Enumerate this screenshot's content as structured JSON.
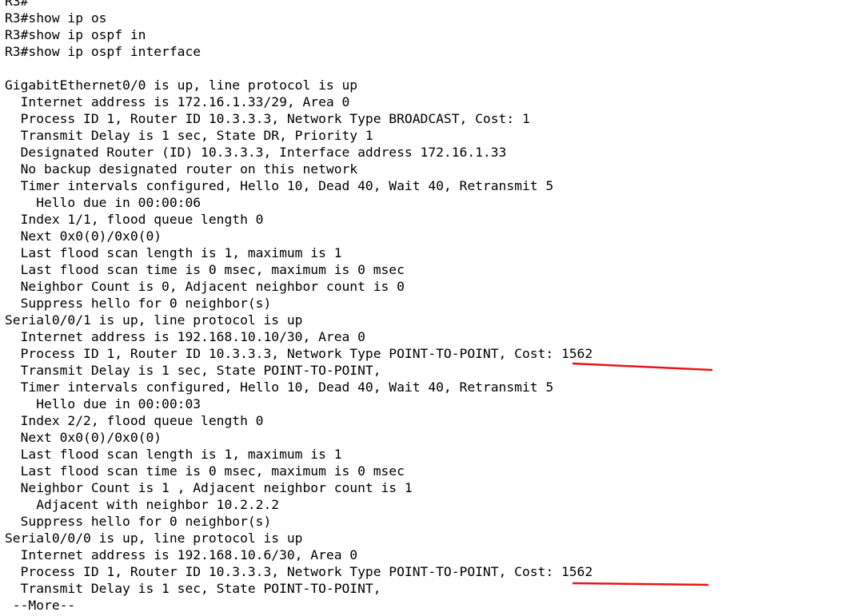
{
  "terminal": {
    "lines": [
      "R3#",
      "R3#show ip os",
      "R3#show ip ospf in",
      "R3#show ip ospf interface",
      "",
      "GigabitEthernet0/0 is up, line protocol is up",
      "  Internet address is 172.16.1.33/29, Area 0",
      "  Process ID 1, Router ID 10.3.3.3, Network Type BROADCAST, Cost: 1",
      "  Transmit Delay is 1 sec, State DR, Priority 1",
      "  Designated Router (ID) 10.3.3.3, Interface address 172.16.1.33",
      "  No backup designated router on this network",
      "  Timer intervals configured, Hello 10, Dead 40, Wait 40, Retransmit 5",
      "    Hello due in 00:00:06",
      "  Index 1/1, flood queue length 0",
      "  Next 0x0(0)/0x0(0)",
      "  Last flood scan length is 1, maximum is 1",
      "  Last flood scan time is 0 msec, maximum is 0 msec",
      "  Neighbor Count is 0, Adjacent neighbor count is 0",
      "  Suppress hello for 0 neighbor(s)",
      "Serial0/0/1 is up, line protocol is up",
      "  Internet address is 192.168.10.10/30, Area 0",
      "  Process ID 1, Router ID 10.3.3.3, Network Type POINT-TO-POINT, Cost: 1562",
      "  Transmit Delay is 1 sec, State POINT-TO-POINT,",
      "  Timer intervals configured, Hello 10, Dead 40, Wait 40, Retransmit 5",
      "    Hello due in 00:00:03",
      "  Index 2/2, flood queue length 0",
      "  Next 0x0(0)/0x0(0)",
      "  Last flood scan length is 1, maximum is 1",
      "  Last flood scan time is 0 msec, maximum is 0 msec",
      "  Neighbor Count is 1 , Adjacent neighbor count is 1",
      "    Adjacent with neighbor 10.2.2.2",
      "  Suppress hello for 0 neighbor(s)",
      "Serial0/0/0 is up, line protocol is up",
      "  Internet address is 192.168.10.6/30, Area 0",
      "  Process ID 1, Router ID 10.3.3.3, Network Type POINT-TO-POINT, Cost: 1562",
      "  Transmit Delay is 1 sec, State POINT-TO-POINT,",
      " --More--"
    ]
  },
  "annotations": {
    "color": "#e8141a"
  }
}
